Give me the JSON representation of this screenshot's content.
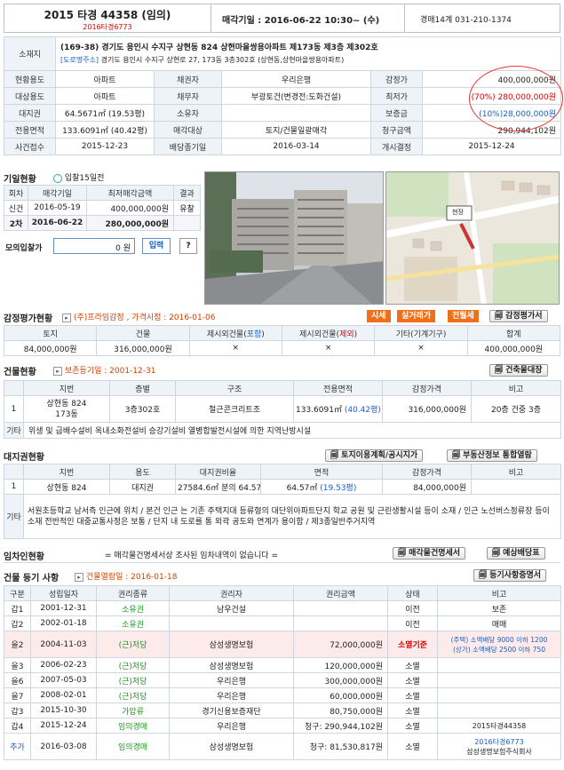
{
  "header": {
    "case": "2015 타경 44358 (임의)",
    "sub_case": "2016타경6773",
    "sale_date": "매각기일 : 2016-06-22 10:30~ (수)",
    "court": "경매14계 031-210-1374"
  },
  "property": {
    "address_label": "소재지",
    "address": "(169-38) 경기도 용인시 수지구 상현동 824 상현마을쌍용아파트 제173동 제3층 제302호",
    "road_tag": "[도로명주소]",
    "road_address": "경기도 용인시 수지구 상현로 27, 173동 3층302호 (상현동,상현마을쌍용아파트)",
    "rows": [
      [
        "현황용도",
        "아파트",
        "채권자",
        "우리은행",
        "감정가",
        "400,000,000원"
      ],
      [
        "대상용도",
        "아파트",
        "채무자",
        "부광토건(변경전:도화건설)",
        "최저가",
        "(70%) 280,000,000원"
      ],
      [
        "대지권",
        "64.5671㎡ (19.53평)",
        "소유자",
        "",
        "보증금",
        "(10%)28,000,000원"
      ],
      [
        "전용면적",
        "133.6091㎡ (40.42평)",
        "매각대상",
        "토지/건물일괄매각",
        "청구금액",
        "290,944,102원"
      ],
      [
        "사건접수",
        "2015-12-23",
        "배당종기일",
        "2016-03-14",
        "개시결정",
        "2015-12-24"
      ]
    ]
  },
  "history": {
    "title": "기일현황",
    "badge": "입찰15일전",
    "headers": [
      "회차",
      "매각기일",
      "최저매각금액",
      "결과"
    ],
    "rows": [
      [
        "신건",
        "2016-05-19",
        "400,000,000원",
        "유찰"
      ],
      [
        "2차",
        "2016-06-22",
        "280,000,000원",
        ""
      ]
    ],
    "mock_label": "모의입찰가",
    "mock_value": "0",
    "mock_unit": "원",
    "mock_button": "입력",
    "help_button": "?"
  },
  "photo": {
    "map_marker": "현장"
  },
  "appraisal": {
    "title": "감정평가현황",
    "note": "(주)프라임감정 , 가격시점 : 2016-01-06",
    "btn_market": "시세",
    "btn_trade": "실거래가",
    "btn_rent": "전월세",
    "btn_doc": "감정평가서",
    "headers": [
      "토지",
      "건물",
      "제시외건물(",
      "포함",
      ")",
      "제시외건물(",
      "제외",
      ")",
      "기타(기계기구)",
      "합계"
    ],
    "values": [
      "84,000,000원",
      "316,000,000원",
      "×",
      "×",
      "×",
      "400,000,000원"
    ]
  },
  "building": {
    "title": "건물현황",
    "note": "보존등기일 : 2001-12-31",
    "btn": "건축물대장",
    "headers": [
      "지번",
      "층별",
      "구조",
      "전용면적",
      "감정가격",
      "비고"
    ],
    "row": [
      "1",
      "상현동 824",
      "173동",
      "3층302호",
      "철근콘크리트조",
      "133.6091㎡",
      "(40.42평)",
      "316,000,000원",
      "20층 건중 3층"
    ],
    "etc_label": "기타",
    "etc_text": "위생 및 급배수설비 옥내소화전설비 승강기설비 열병합발전시설에 의한 지역난방시설"
  },
  "land": {
    "title": "대지권현황",
    "btn1": "토지이용계획/공시지가",
    "btn2": "부동산정보 통합열람",
    "headers": [
      "지번",
      "용도",
      "대지권비율",
      "면적",
      "감정가격",
      "비고"
    ],
    "row": [
      "1",
      "상현동 824",
      "대지권",
      "27584.6㎡ 분의 64.57㎡",
      "64.57㎡",
      "(19.53평)",
      "84,000,000원",
      ""
    ],
    "etc_label": "기타",
    "etc_text": "서원초등학교 남서측 인근에 위치 / 본건 인근 는 기존 주택지대 등류형의 대단위아파트단지 학교 공원 및 근린생활시설 등이 소재 / 인근 노선버스정류장 등이 소재 전반적인 대중교통사정은 보통 / 단지 내 도로를 통 외곽 공도와 연계가 용이함 / 제3종일반주거지역"
  },
  "lease": {
    "title": "임차인현황",
    "text": "= 매각물건명세서상 조사된 임차내역이 없습니다 =",
    "btn1": "매각물건명세서",
    "btn2": "예상배당표"
  },
  "registry": {
    "title": "건물 등기 사항",
    "note": "건물열람일 : 2016-01-18",
    "btn": "등기사항증명서",
    "headers": [
      "구분",
      "성립일자",
      "권리종류",
      "권리자",
      "권리금액",
      "상태",
      "비고"
    ],
    "rows": [
      {
        "kind": "갑1",
        "date": "2001-12-31",
        "right": "소유권",
        "holder": "남우건설",
        "amount": "",
        "status": "이전",
        "remark": "보존"
      },
      {
        "kind": "갑2",
        "date": "2002-01-18",
        "right": "소유권",
        "holder": "",
        "amount": "",
        "status": "이전",
        "remark": "매매"
      },
      {
        "kind": "을2",
        "date": "2004-11-03",
        "right": "(근)저당",
        "holder": "삼성생명보험",
        "amount": "72,000,000원",
        "status": "소멸기준",
        "remark": "(주택) 소액배당 9000 이하 1200",
        "remark2": "(상가) 소액배당 2500 이하 750"
      },
      {
        "kind": "을3",
        "date": "2006-02-23",
        "right": "(근)저당",
        "holder": "삼성생명보험",
        "amount": "120,000,000원",
        "status": "소멸",
        "remark": ""
      },
      {
        "kind": "을6",
        "date": "2007-05-03",
        "right": "(근)저당",
        "holder": "우리은행",
        "amount": "300,000,000원",
        "status": "소멸",
        "remark": ""
      },
      {
        "kind": "을7",
        "date": "2008-02-01",
        "right": "(근)저당",
        "holder": "우리은행",
        "amount": "60,000,000원",
        "status": "소멸",
        "remark": ""
      },
      {
        "kind": "갑3",
        "date": "2015-10-30",
        "right": "가압류",
        "holder": "경기신용보증재단",
        "amount": "80,750,000원",
        "status": "소멸",
        "remark": ""
      },
      {
        "kind": "갑4",
        "date": "2015-12-24",
        "right": "임의경매",
        "holder": "우리은행",
        "amount": "청구: 290,944,102원",
        "status": "소멸",
        "remark": "2015타경44358"
      },
      {
        "kind": "추가",
        "date": "2016-03-08",
        "right": "임의경매",
        "holder": "삼성생명보험",
        "amount": "청구: 81,530,817원",
        "status": "소멸",
        "remark": "2016타경6773",
        "remark2": "삼성생명보험주식회사"
      }
    ]
  },
  "colors": {
    "header_bg": "#eef3f8",
    "red": "#dd0000",
    "blue": "#1760c8",
    "green": "#1a9a1a",
    "orange": "#f0701a"
  }
}
